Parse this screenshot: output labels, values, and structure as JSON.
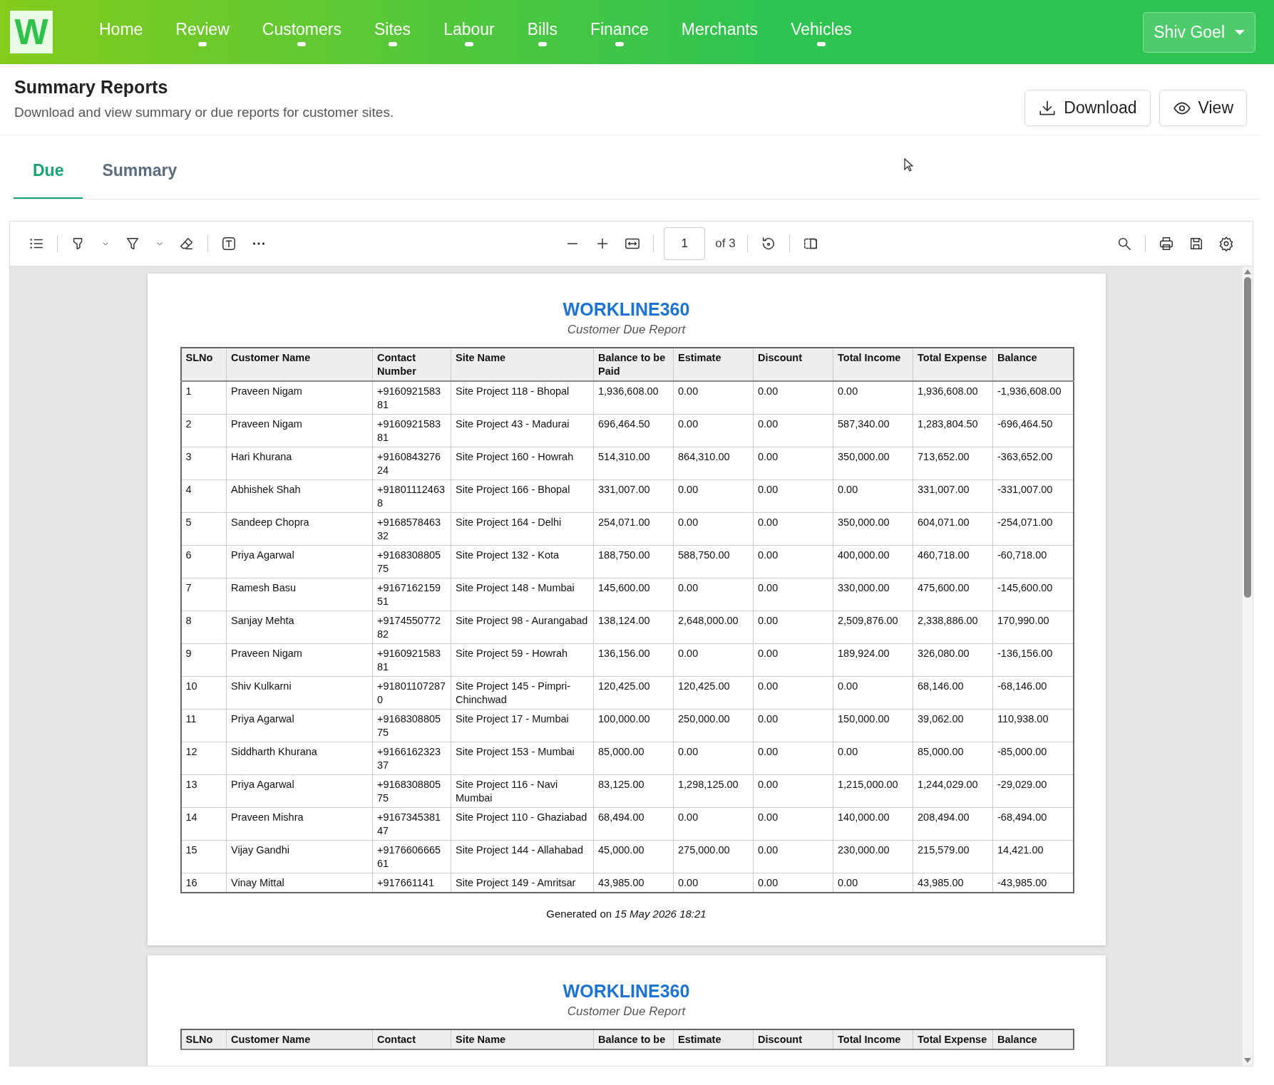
{
  "app": {
    "logo": "W"
  },
  "nav": [
    {
      "label": "Home",
      "has_menu": false
    },
    {
      "label": "Review",
      "has_menu": true
    },
    {
      "label": "Customers",
      "has_menu": true
    },
    {
      "label": "Sites",
      "has_menu": true
    },
    {
      "label": "Labour",
      "has_menu": true
    },
    {
      "label": "Bills",
      "has_menu": true
    },
    {
      "label": "Finance",
      "has_menu": true
    },
    {
      "label": "Merchants",
      "has_menu": false
    },
    {
      "label": "Vehicles",
      "has_menu": true
    }
  ],
  "user": {
    "name": "Shiv Goel"
  },
  "page": {
    "title": "Summary Reports",
    "subtitle": "Download and view summary or due reports for customer sites."
  },
  "actions": [
    {
      "label": "Download",
      "kind": "download"
    },
    {
      "label": "View",
      "kind": "view"
    }
  ],
  "tabs": [
    {
      "label": "Due",
      "selected": true
    },
    {
      "label": "Summary",
      "selected": false
    }
  ],
  "viewer": {
    "page_input": "1",
    "page_count": "of 3"
  },
  "report_pages": [
    {
      "brand": "WORKLINE360",
      "subtitle": "Customer Due Report",
      "columns": [
        "SLNo",
        "Customer Name",
        "Contact Number",
        "Site Name",
        "Balance to be Paid",
        "Estimate",
        "Discount",
        "Total Income",
        "Total Expense",
        "Balance"
      ],
      "rows": [
        [
          "1",
          "Praveen Nigam",
          "+916092158381",
          "Site Project 118 - Bhopal",
          "1,936,608.00",
          "0.00",
          "0.00",
          "0.00",
          "1,936,608.00",
          "-1,936,608.00"
        ],
        [
          "2",
          "Praveen Nigam",
          "+916092158381",
          "Site Project 43 - Madurai",
          "696,464.50",
          "0.00",
          "0.00",
          "587,340.00",
          "1,283,804.50",
          "-696,464.50"
        ],
        [
          "3",
          "Hari Khurana",
          "+916084327624",
          "Site Project 160 - Howrah",
          "514,310.00",
          "864,310.00",
          "0.00",
          "350,000.00",
          "713,652.00",
          "-363,652.00"
        ],
        [
          "4",
          "Abhishek Shah",
          "+918011124638",
          "Site Project 166 - Bhopal",
          "331,007.00",
          "0.00",
          "0.00",
          "0.00",
          "331,007.00",
          "-331,007.00"
        ],
        [
          "5",
          "Sandeep Chopra",
          "+916857846332",
          "Site Project 164 - Delhi",
          "254,071.00",
          "0.00",
          "0.00",
          "350,000.00",
          "604,071.00",
          "-254,071.00"
        ],
        [
          "6",
          "Priya Agarwal",
          "+916830880575",
          "Site Project 132 - Kota",
          "188,750.00",
          "588,750.00",
          "0.00",
          "400,000.00",
          "460,718.00",
          "-60,718.00"
        ],
        [
          "7",
          "Ramesh Basu",
          "+916716215951",
          "Site Project 148 - Mumbai",
          "145,600.00",
          "0.00",
          "0.00",
          "330,000.00",
          "475,600.00",
          "-145,600.00"
        ],
        [
          "8",
          "Sanjay Mehta",
          "+917455077282",
          "Site Project 98 - Aurangabad",
          "138,124.00",
          "2,648,000.00",
          "0.00",
          "2,509,876.00",
          "2,338,886.00",
          "170,990.00"
        ],
        [
          "9",
          "Praveen Nigam",
          "+916092158381",
          "Site Project 59 - Howrah",
          "136,156.00",
          "0.00",
          "0.00",
          "189,924.00",
          "326,080.00",
          "-136,156.00"
        ],
        [
          "10",
          "Shiv Kulkarni",
          "+918011072870",
          "Site Project 145 - Pimpri-Chinchwad",
          "120,425.00",
          "120,425.00",
          "0.00",
          "0.00",
          "68,146.00",
          "-68,146.00"
        ],
        [
          "11",
          "Priya Agarwal",
          "+916830880575",
          "Site Project 17 - Mumbai",
          "100,000.00",
          "250,000.00",
          "0.00",
          "150,000.00",
          "39,062.00",
          "110,938.00"
        ],
        [
          "12",
          "Siddharth Khurana",
          "+916616232337",
          "Site Project 153 - Mumbai",
          "85,000.00",
          "0.00",
          "0.00",
          "0.00",
          "85,000.00",
          "-85,000.00"
        ],
        [
          "13",
          "Priya Agarwal",
          "+916830880575",
          "Site Project 116 - Navi Mumbai",
          "83,125.00",
          "1,298,125.00",
          "0.00",
          "1,215,000.00",
          "1,244,029.00",
          "-29,029.00"
        ],
        [
          "14",
          "Praveen Mishra",
          "+916734538147",
          "Site Project 110 - Ghaziabad",
          "68,494.00",
          "0.00",
          "0.00",
          "140,000.00",
          "208,494.00",
          "-68,494.00"
        ],
        [
          "15",
          "Vijay Gandhi",
          "+917660666561",
          "Site Project 144 - Allahabad",
          "45,000.00",
          "275,000.00",
          "0.00",
          "230,000.00",
          "215,579.00",
          "14,421.00"
        ],
        [
          "16",
          "Vinay Mittal",
          "+917661141",
          "Site Project 149 - Amritsar",
          "43,985.00",
          "0.00",
          "0.00",
          "0.00",
          "43,985.00",
          "-43,985.00"
        ]
      ],
      "footer": "Generated on *15 May 2026 18:21*"
    },
    {
      "brand": "WORKLINE360",
      "subtitle": "Customer Due Report",
      "columns": [
        "SLNo",
        "Customer Name",
        "Contact",
        "Site Name",
        "Balance to be",
        "Estimate",
        "Discount",
        "Total Income",
        "Total Expense",
        "Balance"
      ]
    }
  ]
}
